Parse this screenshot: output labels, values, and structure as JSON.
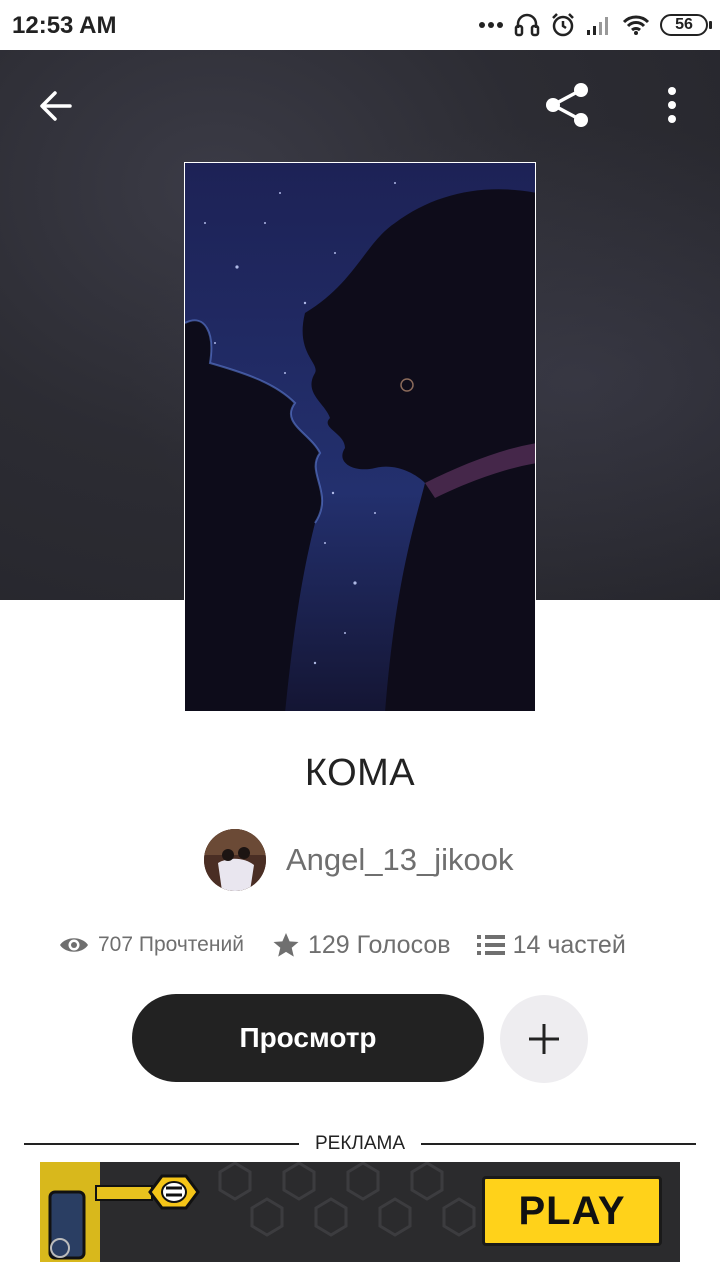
{
  "status_bar": {
    "time": "12:53 AM",
    "battery": "56"
  },
  "toolbar": {
    "back_icon": "arrow-left-icon",
    "share_icon": "share-icon",
    "more_icon": "more-vertical-icon"
  },
  "story": {
    "title": "КОМА",
    "author": "Angel_13_jikook",
    "reads": "707 Прочтений",
    "votes": "129 Голосов",
    "parts": "14 частей"
  },
  "actions": {
    "view_label": "Просмотр",
    "add_icon": "plus-icon"
  },
  "ad": {
    "label": "РЕКЛАМА",
    "cta": "PLAY"
  },
  "colors": {
    "header_bg": "#2c2c33",
    "primary_button": "#222222",
    "secondary_text": "#6f6f6f",
    "ad_accent": "#ffd21a"
  }
}
